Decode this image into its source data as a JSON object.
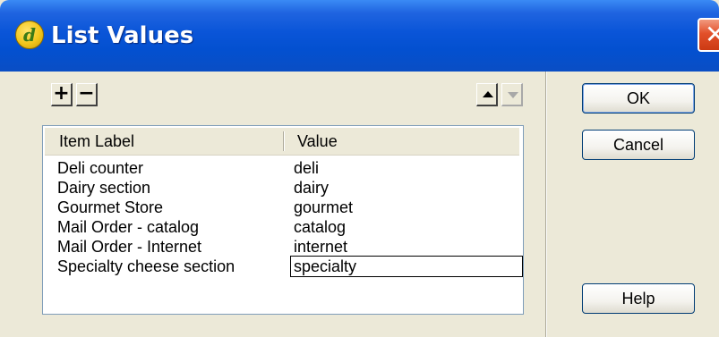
{
  "window": {
    "title": "List Values",
    "app_icon": "dreamweaver-icon",
    "close_glyph": "✕"
  },
  "toolbar": {
    "add_label": "+",
    "remove_label": "−",
    "move_up_icon": "arrow-up-icon",
    "move_down_icon": "arrow-down-icon"
  },
  "list": {
    "columns": [
      "Item Label",
      "Value"
    ],
    "rows": [
      {
        "label": "Deli counter",
        "value": "deli"
      },
      {
        "label": "Dairy section",
        "value": "dairy"
      },
      {
        "label": "Gourmet Store",
        "value": "gourmet"
      },
      {
        "label": "Mail Order - catalog",
        "value": "catalog"
      },
      {
        "label": "Mail Order - Internet",
        "value": "internet"
      },
      {
        "label": "Specialty cheese section",
        "value": "specialty"
      }
    ],
    "editing_row": 5
  },
  "buttons": {
    "ok": "OK",
    "cancel": "Cancel",
    "help": "Help"
  },
  "colors": {
    "titlebar": "#0350d0",
    "close": "#e2502a",
    "face": "#ece9d8"
  }
}
